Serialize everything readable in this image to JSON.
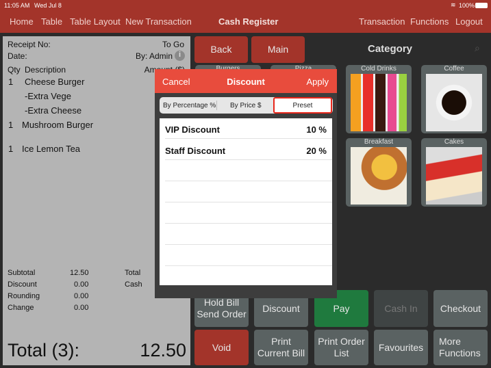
{
  "status": {
    "time": "11:05 AM",
    "date": "Wed Jul 8",
    "battery": "100%"
  },
  "nav": {
    "left": [
      "Home",
      "Table",
      "Table Layout",
      "New Transaction"
    ],
    "title": "Cash Register",
    "right": [
      "Transaction",
      "Functions",
      "Logout"
    ]
  },
  "receipt": {
    "receipt_no": "Receipt No:",
    "order_type": "To Go",
    "date": "Date:",
    "by": "By: Admin",
    "qty": "Qty",
    "description": "Description",
    "amount": "Amount ($)",
    "items": [
      {
        "qty": "1",
        "name": "Cheese Burger"
      },
      {
        "qty": "",
        "name": "-Extra Vege"
      },
      {
        "qty": "",
        "name": "-Extra Cheese"
      },
      {
        "qty": "1",
        "name": "Mushroom Burger"
      },
      {
        "qty": "1",
        "name": "Ice Lemon Tea"
      }
    ],
    "subtotal_label": "Subtotal",
    "subtotal": "12.50",
    "discount_label": "Discount",
    "discount": "0.00",
    "rounding_label": "Rounding",
    "rounding": "0.00",
    "change_label": "Change",
    "change": "0.00",
    "total_label": "Total",
    "cash_label": "Cash",
    "grand_total_label": "Total (3):",
    "grand_total": "12.50"
  },
  "category": {
    "back": "Back",
    "main": "Main",
    "title": "Category",
    "tiles": [
      "Burgers",
      "Pizza",
      "Cold Drinks",
      "Coffee",
      "Breakfast",
      "Cakes"
    ]
  },
  "modal": {
    "cancel": "Cancel",
    "title": "Discount",
    "apply": "Apply",
    "segments": [
      "By Percentage %",
      "By Price $",
      "Preset"
    ],
    "selected": "Preset",
    "rows": [
      {
        "name": "VIP Discount",
        "value": "10 %"
      },
      {
        "name": "Staff Discount",
        "value": "20 %"
      }
    ]
  },
  "actions": [
    "Hold Bill\nSend Order",
    "Discount",
    "Pay",
    "Cash In",
    "Checkout",
    "Void",
    "Print\nCurrent Bill",
    "Print Order\nList",
    "Favourites",
    "More\nFunctions"
  ],
  "colors": {
    "bar": "#a3342a",
    "modal_header": "#e84c3d",
    "pay": "#1f7a3e"
  }
}
